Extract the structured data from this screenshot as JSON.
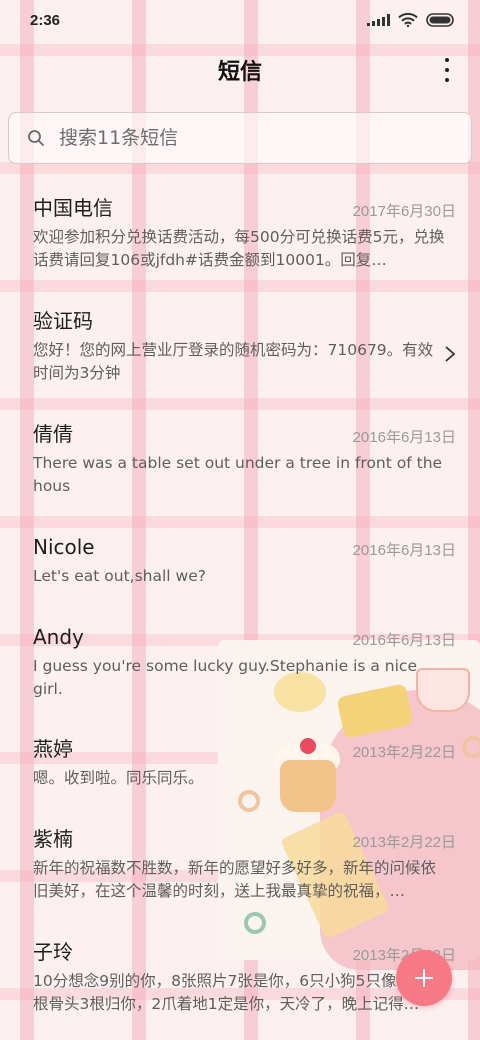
{
  "status_bar": {
    "time": "2:36"
  },
  "header": {
    "title": "短信"
  },
  "search": {
    "placeholder": "搜索11条短信"
  },
  "messages": [
    {
      "name": "中国电信",
      "date": "2017年6月30日",
      "text": "欢迎参加积分兑换话费活动，每500分可兑换话费5元，兑换话费请回复106或jfdh#话费金额到10001。回复…"
    },
    {
      "name": "验证码",
      "date": "",
      "text": "您好！您的网上营业厅登录的随机密码为：710679。有效时间为3分钟"
    },
    {
      "name": "倩倩",
      "date": "2016年6月13日",
      "text": "There was a table set out under a tree in front of the hous"
    },
    {
      "name": "Nicole",
      "date": "2016年6月13日",
      "text": "Let's eat out,shall we?"
    },
    {
      "name": "Andy",
      "date": "2016年6月13日",
      "text": "I guess you're some lucky guy.Stephanie is a nice girl."
    },
    {
      "name": "燕婷",
      "date": "2013年2月22日",
      "text": "嗯。收到啦。同乐同乐。"
    },
    {
      "name": "紫楠",
      "date": "2013年2月22日",
      "text": "新年的祝福数不胜数，新年的愿望好多好多，新年的问候依旧美好，在这个温馨的时刻，送上我最真挚的祝福，…"
    },
    {
      "name": "子玲",
      "date": "2013年2月22日",
      "text": "10分想念9别的你，8张照片7张是你，6只小狗5只像你，4根骨头3根归你，2爪着地1定是你，天冷了，晚上记得…"
    }
  ],
  "icons": {
    "search": "search-icon",
    "more": "more-vertical-icon",
    "chevron": "chevron-right-icon",
    "fab": "plus-icon"
  },
  "colors": {
    "accent": "#f57a86"
  }
}
